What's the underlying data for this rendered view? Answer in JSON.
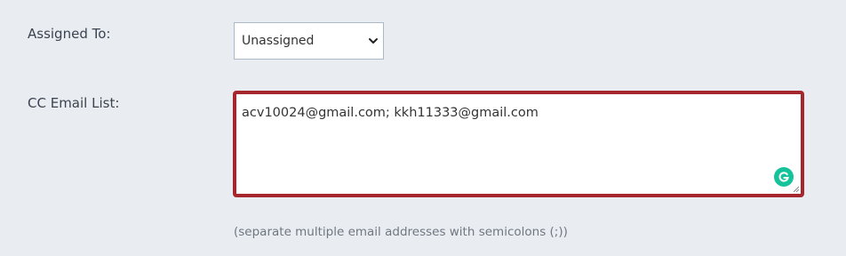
{
  "assigned_to": {
    "label": "Assigned To:",
    "selected_value": "Unassigned",
    "icon": "chevron-down-icon"
  },
  "cc_email": {
    "label": "CC Email List:",
    "value": "acv10024@gmail.com; kkh11333@gmail.com",
    "helper_text": "(separate multiple email addresses with semicolons (;))",
    "border_color": "#a6262e",
    "icon": "grammarly-icon"
  }
}
